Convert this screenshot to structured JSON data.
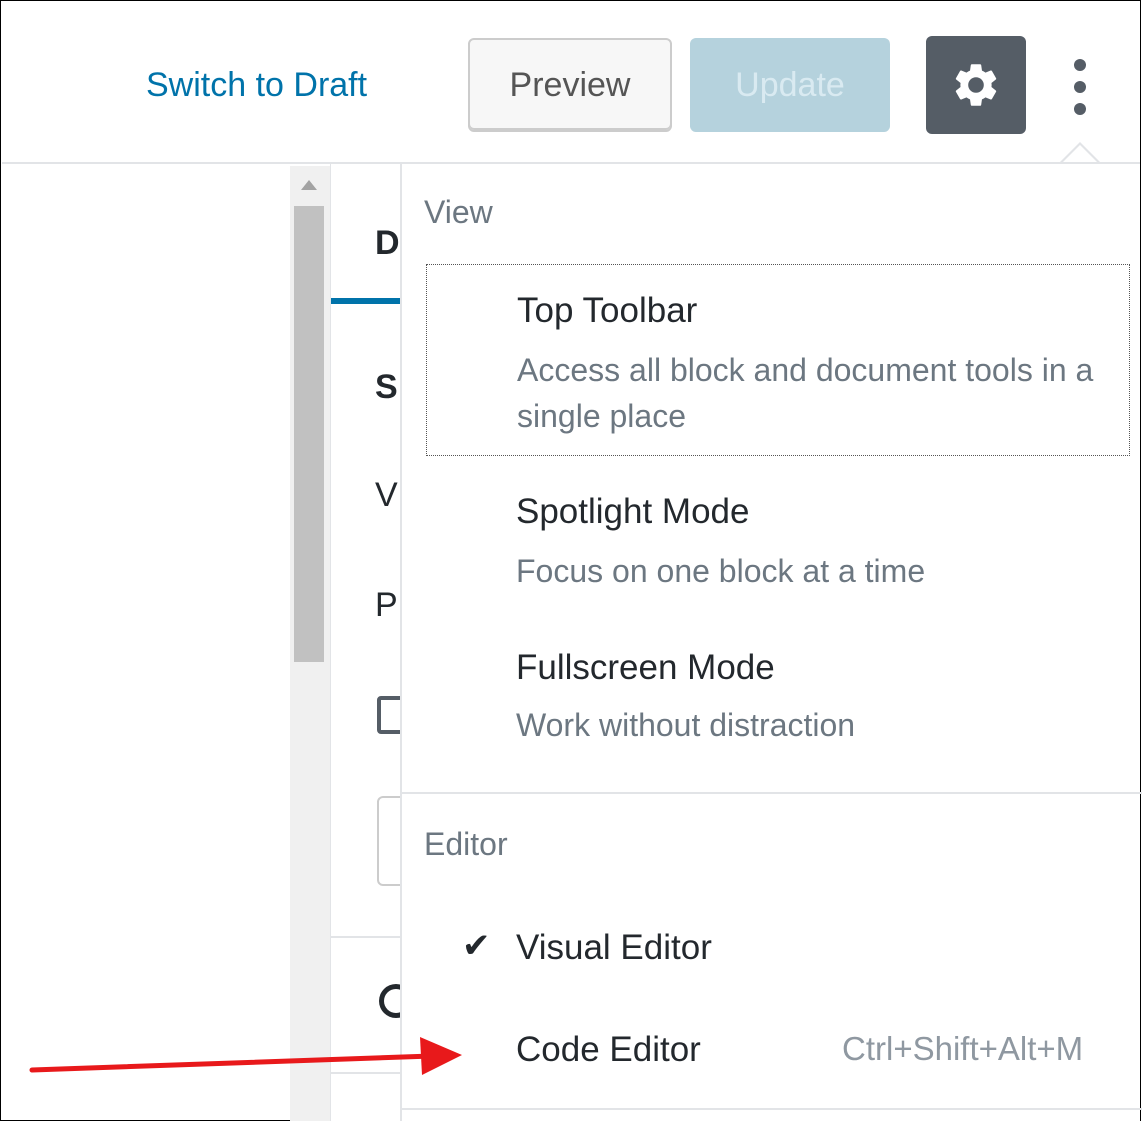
{
  "header": {
    "switch_to_draft": "Switch to Draft",
    "preview_label": "Preview",
    "update_label": "Update",
    "settings_icon": "gear-icon",
    "more_icon": "vertical-ellipsis-icon"
  },
  "sidebar": {
    "tab_letter": "D",
    "letters": [
      "S",
      "V",
      "P"
    ]
  },
  "menu": {
    "view_group": {
      "label": "View",
      "items": [
        {
          "title": "Top Toolbar",
          "description": "Access all block and document tools in a single place"
        },
        {
          "title": "Spotlight Mode",
          "description": "Focus on one block at a time"
        },
        {
          "title": "Fullscreen Mode",
          "description": "Work without distraction"
        }
      ]
    },
    "editor_group": {
      "label": "Editor",
      "items": [
        {
          "title": "Visual Editor",
          "checked": "✔",
          "shortcut": ""
        },
        {
          "title": "Code Editor",
          "checked": "",
          "shortcut": "Ctrl+Shift+Alt+M"
        }
      ]
    }
  },
  "colors": {
    "accent": "#0073aa",
    "settings_bg": "#555d66",
    "update_disabled_bg": "#b5d2dd",
    "arrow": "#e8191b"
  }
}
